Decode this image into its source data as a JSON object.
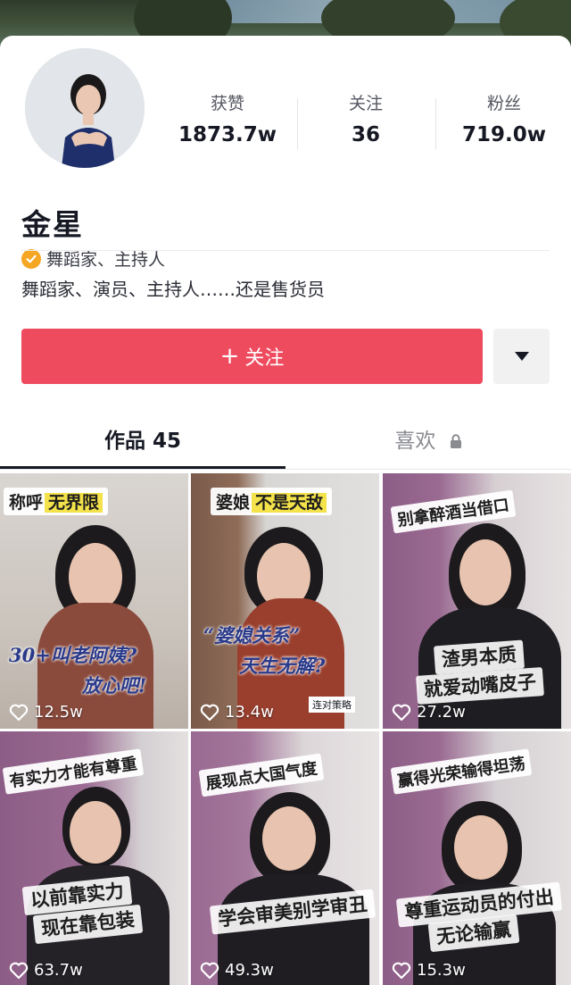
{
  "profile": {
    "name": "金星",
    "verification": "舞蹈家、主持人",
    "bio": "舞蹈家、演员、主持人……还是售货员",
    "stats": [
      {
        "label": "获赞",
        "value": "1873.7w"
      },
      {
        "label": "关注",
        "value": "36"
      },
      {
        "label": "粉丝",
        "value": "719.0w"
      }
    ]
  },
  "actions": {
    "follow_label": "关注",
    "follow_plus": "+"
  },
  "tabs": {
    "works_label": "作品 45",
    "likes_label": "喜欢"
  },
  "colors": {
    "follow_button": "#ee4b5f",
    "verify_badge": "#f5a623",
    "text_primary": "#161823",
    "text_muted": "#8a8b91"
  },
  "videos": [
    {
      "likes": "12.5w",
      "caption_a": "称呼",
      "caption_b": "无界限",
      "overlay_1": "30+叫老阿姨?",
      "overlay_2": "放心吧!"
    },
    {
      "likes": "13.4w",
      "caption_a": "婆娘",
      "caption_b": "不是天敌",
      "overlay_1": "“婆媳关系”",
      "overlay_2": "天生无解?",
      "small_tag": "连对策略"
    },
    {
      "likes": "27.2w",
      "top_caption": "别拿醉酒当借口",
      "mid_caption_1": "渣男本质",
      "mid_caption_2": "就爱动嘴皮子"
    },
    {
      "likes": "63.7w",
      "top_caption": "有实力才能有尊重",
      "mid_caption_1": "以前靠实力",
      "mid_caption_2": "现在靠包装"
    },
    {
      "likes": "49.3w",
      "top_caption": "展现点大国气度",
      "mid_caption_1": "学会审美别学审丑"
    },
    {
      "likes": "15.3w",
      "top_caption": "赢得光荣输得坦荡",
      "mid_caption_1": "尊重运动员的付出",
      "mid_caption_2": "无论输赢"
    }
  ]
}
